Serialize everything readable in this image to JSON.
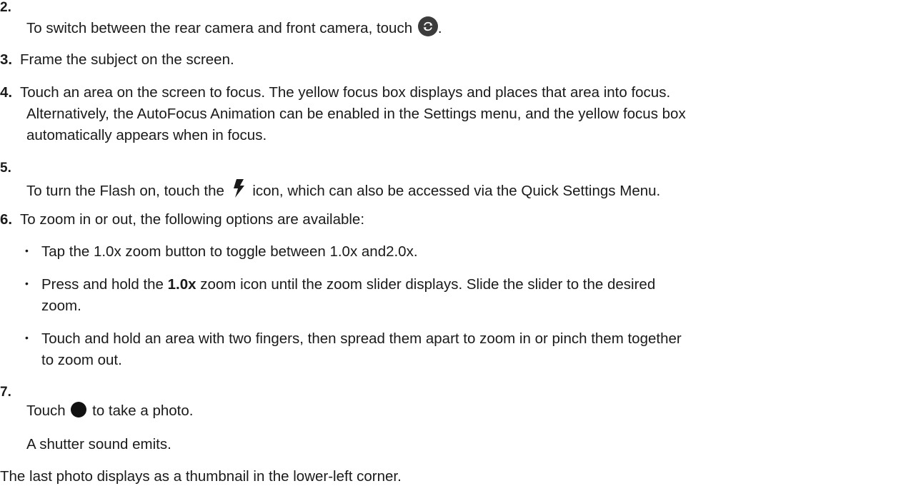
{
  "steps": [
    {
      "num": "2.",
      "text_before": "To switch between the rear camera and front camera, touch",
      "text_after": ".",
      "icon": "camera-switch-icon"
    },
    {
      "num": "3.",
      "text": "Frame the subject on the screen."
    },
    {
      "num": "4.",
      "lines": [
        "Touch an area on the screen to focus. The yellow focus box displays and places that area into focus.",
        "Alternatively, the AutoFocus Animation can be enabled in the Settings menu, and the yellow focus box",
        "automatically appears when in focus."
      ]
    },
    {
      "num": "5.",
      "text_before": "To turn the Flash on, touch the",
      "text_after": "icon, which can also be accessed via the Quick Settings Menu.",
      "icon": "flash-icon"
    },
    {
      "num": "6.",
      "text": "To zoom in or out, the following options are available:"
    },
    {
      "num": "7.",
      "text_before": "Touch",
      "text_after": "to take a photo.",
      "icon": "shutter-icon"
    }
  ],
  "zoom_options": [
    {
      "text": "Tap the 1.0x zoom button to toggle between 1.0x and2.0x."
    },
    {
      "before": "Press and hold the ",
      "bold": "1.0x",
      "after": " zoom icon until the zoom slider displays. Slide the slider to the desired",
      "continuation": "zoom."
    },
    {
      "text": "Touch and hold an area with two fingers, then spread them apart to zoom in or pinch them together",
      "continuation": "to zoom out."
    }
  ],
  "bullet_symbol": "•",
  "step7_result": "A shutter sound emits.",
  "closing_text": "The last photo displays as a thumbnail in the lower-left corner.",
  "colors": {
    "text": "#1a1a1a",
    "switch_icon_bg": "#3c3c3c",
    "shutter_icon": "#111111"
  }
}
